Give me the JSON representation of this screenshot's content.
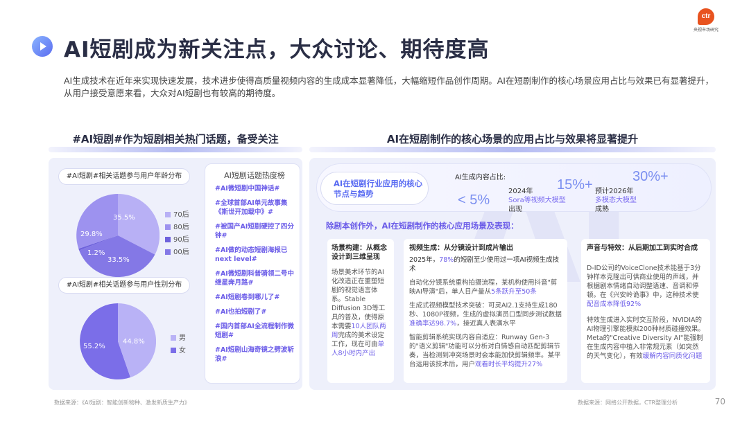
{
  "logo": {
    "mark": "ctr",
    "text": "央视市场研究"
  },
  "title": "AI短剧成为新关注点，大众讨论、期待度高",
  "intro": "AI生成技术在近年来实现快速发展，技术进步使得高质量视频内容的生成成本显著降低，大幅缩短作品创作周期。AI在短剧制作的核心场景应用占比与效果已有显著提升，从用户接受意愿来看，大众对AI短剧也有较高的期待度。",
  "left": {
    "section_title": "#AI短剧#作为短剧相关热门话题，备受关注",
    "age_chart": {
      "title": "#AI短剧#相关话题参与用户年龄分布",
      "labels": [
        "35.5%",
        "29.8%",
        "1.2%",
        "33.5%"
      ],
      "legend": [
        "70后",
        "80后",
        "90后",
        "00后"
      ]
    },
    "gender_chart": {
      "title": "#AI短剧#相关话题参与用户性别分布",
      "labels": [
        "55.2%",
        "44.8%"
      ],
      "legend": [
        "男",
        "女"
      ]
    },
    "hot_list": {
      "title": "AI短剧话题热度榜",
      "items": [
        "#AI微短剧中国神话#",
        "#全球首部AI单元故事集《斯世开加载中》#",
        "#被国产AI短剧硬控了四分钟#",
        "#AI做的动态短剧海报已next level#",
        "#AI微短剧科普骑领二号中继星奔月路#",
        "#AI短剧卷到哪儿了#",
        "#AI也拍短剧了#",
        "#国内首部AI全流程制作微短剧#",
        "#AI短剧山海奇镜之劈波斩浪#"
      ]
    },
    "source": "数据来源：《AI短剧：智能创新物种、激发新质生产力》"
  },
  "right": {
    "section_title": "AI在短剧制作的核心场景的应用占比与效果将显著提升",
    "trend_pill": "AI在短剧行业应用的核心节点与趋势",
    "gen_label": "AI生成内容占比:",
    "stats": {
      "s1_value": "< 5%",
      "s2_value": "15%+",
      "s2_text_a": "2024年",
      "s2_text_b": "Sora等视频大模型",
      "s2_text_c": "出现",
      "s3_value": "30%+",
      "s3_text_a": "预计2026年",
      "s3_text_b": "多模态大模型",
      "s3_text_c": "成熟"
    },
    "sub_heading": "除剧本创作外，AI在短剧制作的核心应用场景及表现：",
    "cards": [
      {
        "head": "场景构建：从概念设计到三维呈现",
        "body_a": "场景美术环节的AI化改造正在重塑短剧的视觉语言体系。Stable Diffusion 3D等工具的普及，使得原本需要",
        "body_hl": "10人团队两周",
        "body_b": "完成的美术设定工作，现在可由",
        "body_hl2": "单人8小时内产出"
      },
      {
        "head": "视频生成：从分镜设计到成片输出",
        "p1_a": "2025年，",
        "p1_hl": "78%",
        "p1_b": "的短剧至少使用过一项AI视频生成技术",
        "p2_a": "自动化分镜系统重构拍摄流程，某机构使用抖音\"剪映AI导演\"后，单人日产量从",
        "p2_hl": "5条跃升至50条",
        "p3_a": "生成式视频模型技术突破：可灵AI2.1支持生成180秒、1080P视频，生成的虚拟演员口型同步测试数据",
        "p3_hl": "准确率达98.7%",
        "p3_b": "，接近真人表演水平",
        "p4_a": "智能剪辑系统实现内容自适应：Runway Gen-3的\"语义剪辑\"功能可以分析对白情感自动匹配剪辑节奏，当检测到冲突场景时会本能加快剪辑频率。某平台运用该技术后，用户",
        "p4_hl": "观看时长平均提升27%"
      },
      {
        "head": "声音与特效：从后期加工到实时合成",
        "p1_a": "D-ID公司的VoiceClone技术能基于3分钟样本克隆出可供商业使用的声线，并根据剧本情绪自动调整语速、音调和停顿。在《兴安岭诡事》中，这种技术使",
        "p1_hl": "配音成本降低92%",
        "p2_a": "特效生成进入实时交互阶段，NVIDIA的AI物理引擎能模拟200种材质碰撞效果。Meta的\"Creative Diversity AI\"能强制在生成内容中植入非常规元素（如突然的天气变化），有效",
        "p2_hl": "缓解内容同质化问题"
      }
    ],
    "source": "数据来源：网络公开数据，CTR整理分析"
  },
  "page_number": "70",
  "colors": {
    "accent": "#6b5ce8",
    "pie_70": "#b8b0f5",
    "pie_80": "#9d92ef",
    "pie_90": "#6e62dc",
    "pie_00": "#8478e6",
    "pie_male": "#b9b2f6",
    "pie_female": "#7b6ee8"
  }
}
